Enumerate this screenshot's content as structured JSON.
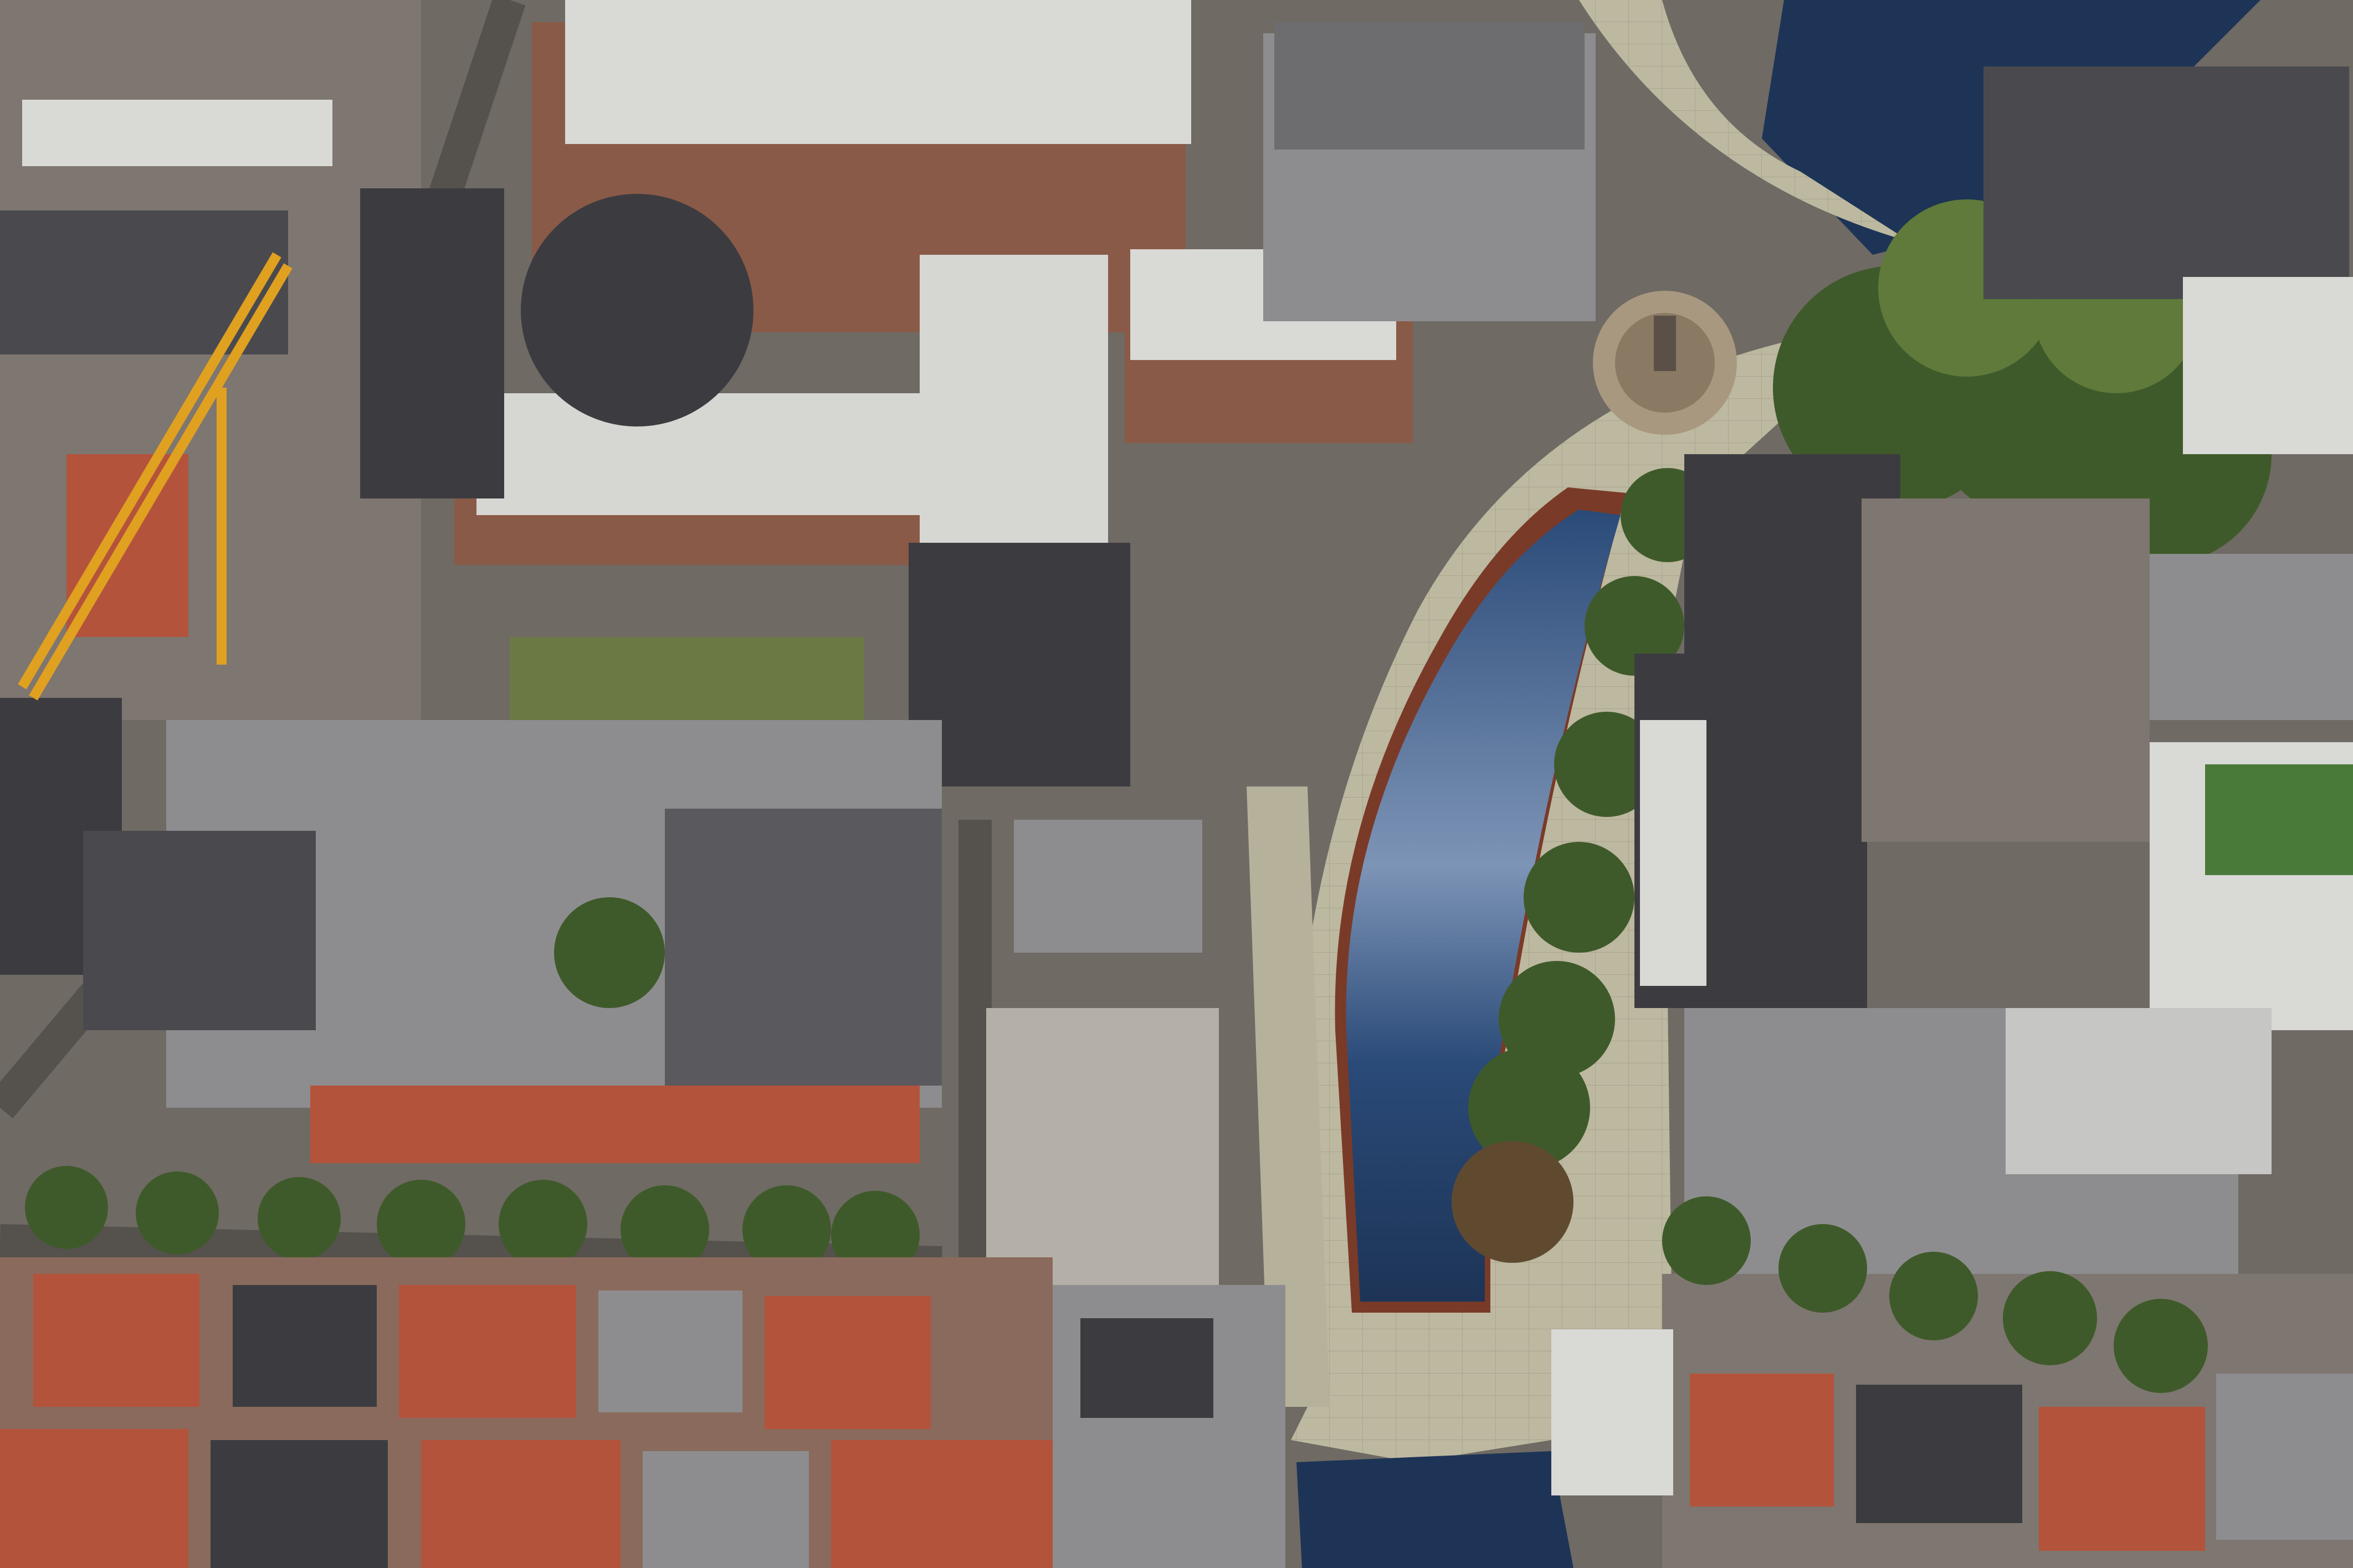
{
  "scene": {
    "kind": "aerial-render",
    "colors": {
      "ground": "#6f6a64",
      "plaza": "#bdb8a0",
      "plaza_edge": "#a8a38c",
      "water": "#1d3456",
      "water_light": "#6f86a8",
      "pool_rim": "#7a3a28",
      "roof_red": "#b4533c",
      "roof_dark": "#3c3c40",
      "roof_grey": "#8d8d8f",
      "roof_white": "#d9d9d6",
      "brick": "#8a5a48",
      "tree": "#3f5a2a",
      "tree_light": "#5f7a3a",
      "lawn": "#6b7a45",
      "crane": "#e0a020"
    }
  }
}
